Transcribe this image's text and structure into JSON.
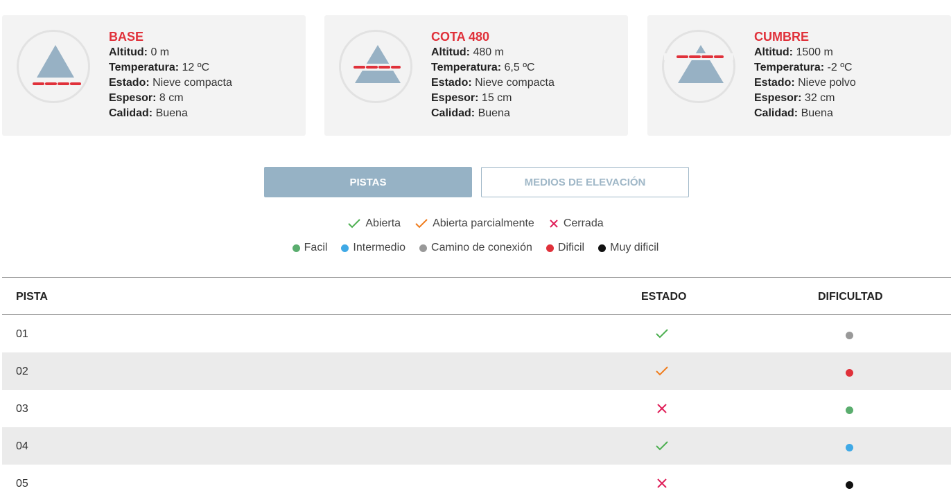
{
  "stations": [
    {
      "name": "BASE",
      "rows": [
        {
          "label": "Altitud:",
          "value": "0 m"
        },
        {
          "label": "Temperatura:",
          "value": "12 ºC"
        },
        {
          "label": "Estado:",
          "value": "Nieve compacta"
        },
        {
          "label": "Espesor:",
          "value": "8 cm"
        },
        {
          "label": "Calidad:",
          "value": "Buena"
        }
      ],
      "icon": "mountain-base-icon"
    },
    {
      "name": "COTA 480",
      "rows": [
        {
          "label": "Altitud:",
          "value": "480 m"
        },
        {
          "label": "Temperatura:",
          "value": "6,5 ºC"
        },
        {
          "label": "Estado:",
          "value": "Nieve compacta"
        },
        {
          "label": "Espesor:",
          "value": "15 cm"
        },
        {
          "label": "Calidad:",
          "value": "Buena"
        }
      ],
      "icon": "mountain-mid-icon"
    },
    {
      "name": "CUMBRE",
      "rows": [
        {
          "label": "Altitud:",
          "value": "1500 m"
        },
        {
          "label": "Temperatura:",
          "value": "-2 ºC"
        },
        {
          "label": "Estado:",
          "value": "Nieve polvo"
        },
        {
          "label": "Espesor:",
          "value": "32 cm"
        },
        {
          "label": "Calidad:",
          "value": "Buena"
        }
      ],
      "icon": "mountain-summit-icon"
    }
  ],
  "tabs": {
    "active_label": "PISTAS",
    "inactive_label": "MEDIOS DE ELEVACIÓN"
  },
  "legend_status": [
    {
      "label": "Abierta",
      "icon": "check-icon",
      "color": "#4caf50"
    },
    {
      "label": "Abierta parcialmente",
      "icon": "check-icon",
      "color": "#f07d1e"
    },
    {
      "label": "Cerrada",
      "icon": "cross-icon",
      "color": "#e0205a"
    }
  ],
  "legend_difficulty": [
    {
      "label": "Facil",
      "color": "#5aad6e"
    },
    {
      "label": "Intermedio",
      "color": "#3fa9e6"
    },
    {
      "label": "Camino de conexión",
      "color": "#999999"
    },
    {
      "label": "Dificil",
      "color": "#e0313a"
    },
    {
      "label": "Muy dificil",
      "color": "#111111"
    }
  ],
  "table": {
    "headers": {
      "pista": "PISTA",
      "estado": "ESTADO",
      "dificultad": "DIFICULTAD"
    },
    "rows": [
      {
        "pista": "01",
        "estado": "abierta",
        "dificultad": "Camino de conexión"
      },
      {
        "pista": "02",
        "estado": "abierta parcialmente",
        "dificultad": "Dificil"
      },
      {
        "pista": "03",
        "estado": "cerrada",
        "dificultad": "Facil"
      },
      {
        "pista": "04",
        "estado": "abierta",
        "dificultad": "Intermedio"
      },
      {
        "pista": "05",
        "estado": "cerrada",
        "dificultad": "Muy dificil"
      }
    ]
  },
  "colors": {
    "accent_red": "#e0313a",
    "mountain": "#97b1c4",
    "tab_active_bg": "#96b2c5",
    "tab_inactive_text": "#9fb7c7",
    "row_alt_bg": "#ebebeb"
  }
}
